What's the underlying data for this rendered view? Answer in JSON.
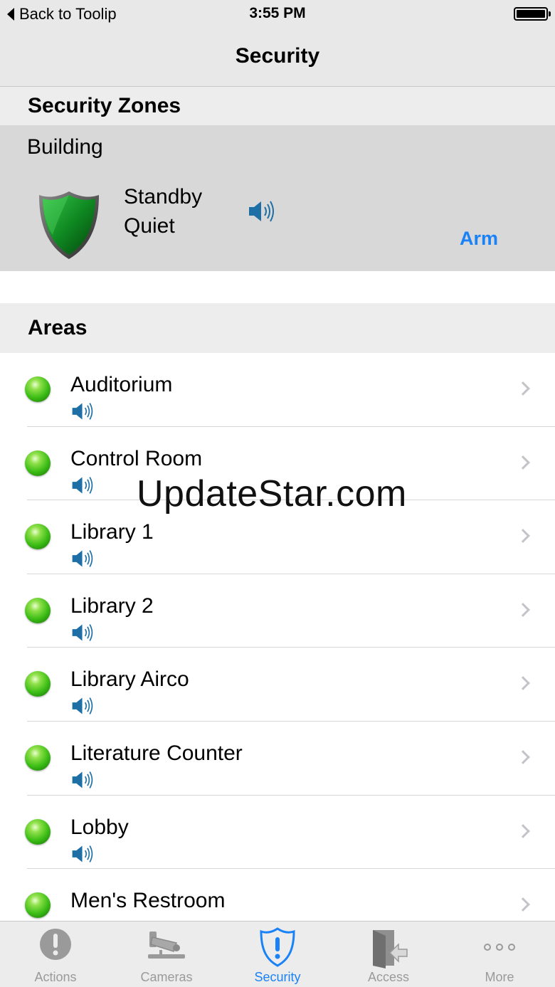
{
  "status_bar": {
    "back_label": "Back to Toolip",
    "time": "3:55 PM"
  },
  "nav": {
    "title": "Security"
  },
  "zones": {
    "header": "Security Zones",
    "items": [
      {
        "name": "Building",
        "status": "Standby",
        "sound": "Quiet",
        "action": "Arm",
        "shield_color": "#0f7a1e"
      }
    ]
  },
  "areas": {
    "header": "Areas",
    "items": [
      {
        "label": "Auditorium"
      },
      {
        "label": "Control Room"
      },
      {
        "label": "Library 1"
      },
      {
        "label": "Library 2"
      },
      {
        "label": "Library Airco"
      },
      {
        "label": "Literature Counter"
      },
      {
        "label": "Lobby"
      },
      {
        "label": "Men's Restroom"
      }
    ]
  },
  "watermark": "UpdateStar.com",
  "tabs": [
    {
      "label": "Actions",
      "icon": "exclamation-circle-icon",
      "active": false
    },
    {
      "label": "Cameras",
      "icon": "camera-icon",
      "active": false
    },
    {
      "label": "Security",
      "icon": "shield-alert-icon",
      "active": true
    },
    {
      "label": "Access",
      "icon": "door-exit-icon",
      "active": false
    },
    {
      "label": "More",
      "icon": "more-dots-icon",
      "active": false
    }
  ],
  "colors": {
    "accent": "#1a82f7",
    "led_green": "#3fbf18",
    "speaker_blue": "#1d6fa5"
  }
}
